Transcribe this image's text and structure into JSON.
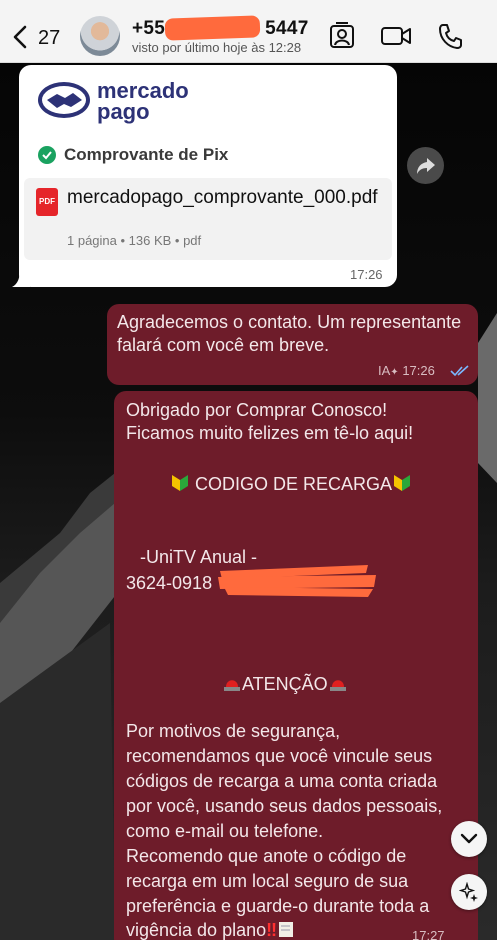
{
  "header": {
    "back_count": "27",
    "contact_name_prefix": "+55",
    "contact_name_suffix": "5447",
    "status": "visto por último hoje às 12:28"
  },
  "incoming": {
    "brand_line1": "mercado",
    "brand_line2": "pago",
    "banner_subtitle": "Comprovante de Pix",
    "file_name": "mercadopago_comprovante_000.pdf",
    "file_meta": "1 página • 136 KB • pdf",
    "pdf_label": "PDF",
    "time": "17:26"
  },
  "outgoing_1": {
    "text": "Agradecemos o contato. Um representante falará com você em breve.",
    "ai_label": "IA",
    "time": "17:26"
  },
  "outgoing_2": {
    "line1": "Obrigado por Comprar Conosco!",
    "line2": "Ficamos muito felizes em tê-lo aqui!",
    "recharge_heading": "CODIGO DE RECARGA",
    "plan": "-UniTV Anual -",
    "code_visible": "3624-0918",
    "attention": "ATENÇÃO",
    "para1": [
      "Por motivos de segurança,",
      "recomendamos que você vincule seus",
      "códigos de recarga a uma conta criada",
      "por você, usando seus dados pessoais,",
      "como e-mail ou telefone."
    ],
    "para2": [
      "Recomendo que anote o código de",
      "recarga em um local seguro de sua",
      "preferência e guarde-o durante toda a",
      "vigência do plano"
    ],
    "time": "17:27"
  },
  "colors": {
    "outgoing_bubble": "#6e1c2a",
    "redaction": "#ff6a3d"
  },
  "icons": [
    "back-chevron-icon",
    "contact-card-icon",
    "video-call-icon",
    "phone-icon",
    "forward-icon",
    "check-circle-icon",
    "pdf-icon",
    "double-check-icon",
    "chevron-down-icon",
    "sparkle-icon"
  ]
}
